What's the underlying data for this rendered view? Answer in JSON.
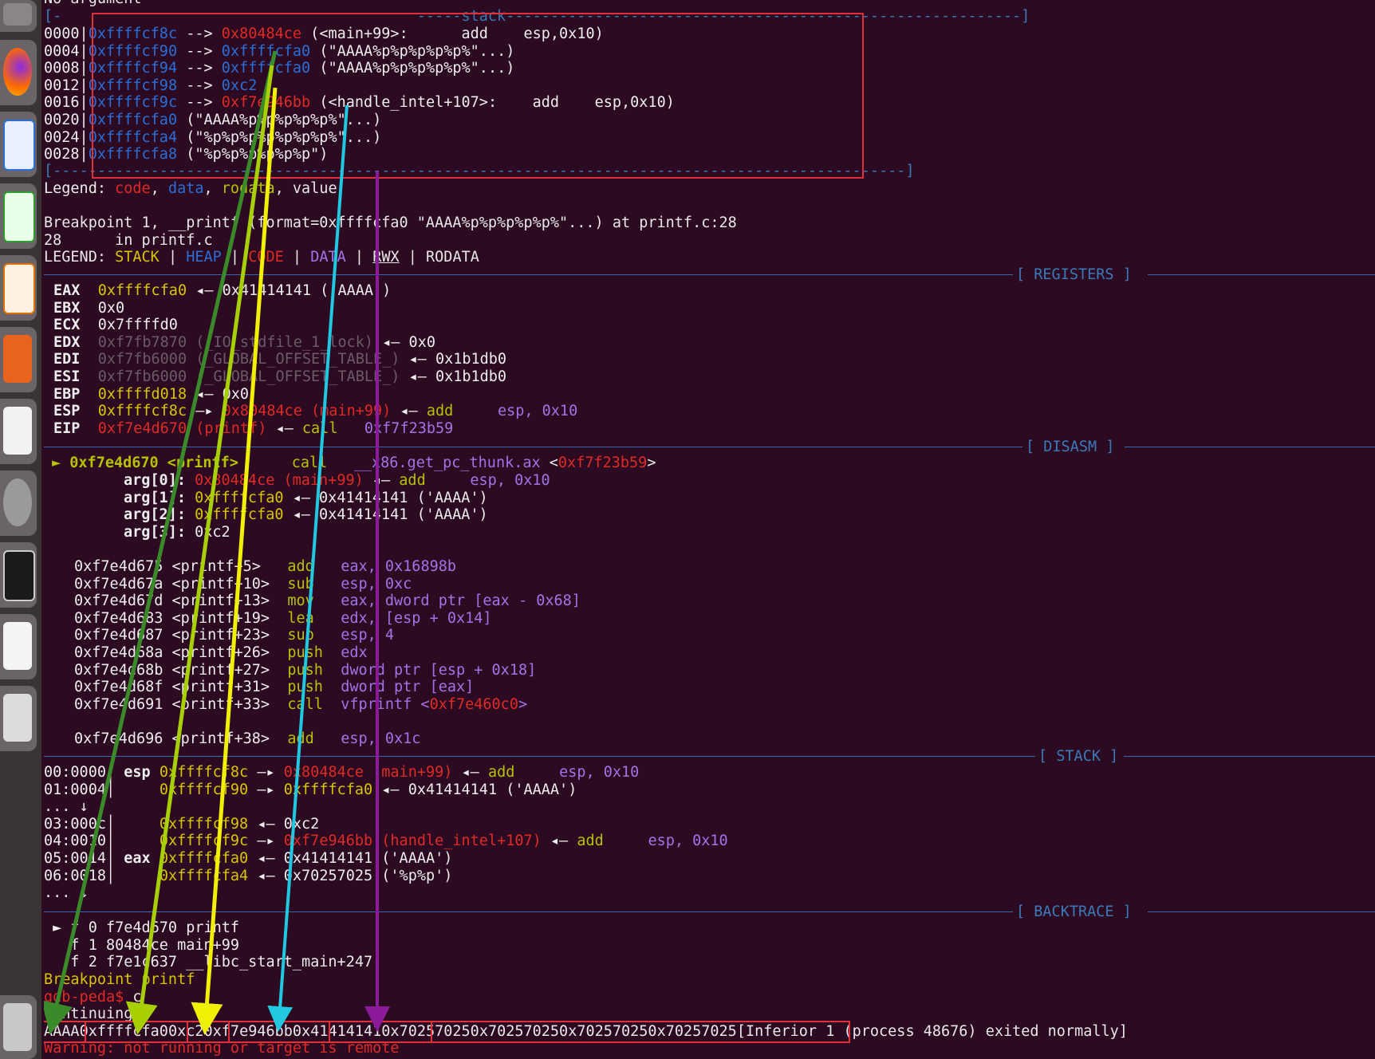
{
  "header": {
    "cut_line": "No argument"
  },
  "stack_top": {
    "section": "stack",
    "rows": [
      {
        "off": "0000|",
        "addr": "0xffffcf8c",
        "arrow": " --> ",
        "val": "0x80484ce",
        "rest": " (<main+99>:      add    esp,0x10)"
      },
      {
        "off": "0004|",
        "addr": "0xffffcf90",
        "arrow": " --> ",
        "val": "0xffffcfa0",
        "rest": " (\"AAAA%p%p%p%p%p%\"...)"
      },
      {
        "off": "0008|",
        "addr": "0xffffcf94",
        "arrow": " --> ",
        "val": "0xffffcfa0",
        "rest": " (\"AAAA%p%p%p%p%p%\"...)"
      },
      {
        "off": "0012|",
        "addr": "0xffffcf98",
        "arrow": " --> ",
        "val": "0xc2",
        "rest": ""
      },
      {
        "off": "0016|",
        "addr": "0xffffcf9c",
        "arrow": " --> ",
        "val": "0xf7e946bb",
        "rest": " (<handle_intel+107>:    add    esp,0x10)"
      },
      {
        "off": "0020|",
        "addr": "0xffffcfa0",
        "arrow": " ",
        "val": "",
        "rest": "(\"AAAA%p%p%p%p%p%\"...)"
      },
      {
        "off": "0024|",
        "addr": "0xffffcfa4",
        "arrow": " ",
        "val": "",
        "rest": "(\"%p%p%p%p%p%p%p%\"...)"
      },
      {
        "off": "0028|",
        "addr": "0xffffcfa8",
        "arrow": " ",
        "val": "",
        "rest": "(\"%p%p%p%p%p%p\")"
      }
    ],
    "legend_label": "Legend: ",
    "legend_code": "code",
    "legend_data": "data",
    "legend_rodata": "rodata",
    "legend_value": "value"
  },
  "bp": {
    "line1": "Breakpoint 1, __printf (format=0xffffcfa0 \"AAAA%p%p%p%p%p%\"...) at printf.c:28",
    "line2": "28\tin printf.c",
    "legend_label": "LEGEND: ",
    "stack": "STACK",
    "heap": "HEAP",
    "code": "CODE",
    "data": "DATA",
    "rwx": "RWX",
    "rodata": "RODATA",
    "sep": " | "
  },
  "sections": {
    "registers": "[ REGISTERS ]",
    "disasm": "[ DISASM ]",
    "stack": "[ STACK ]",
    "backtrace": "[ BACKTRACE ]"
  },
  "registers": [
    {
      "name": "EAX",
      "val": "0xffffcfa0",
      "rest": " ◂— 0x41414141 ('AAAA')"
    },
    {
      "name": "EBX",
      "val": "0x0",
      "rest": ""
    },
    {
      "name": "ECX",
      "val": "0x7ffffd0",
      "rest": ""
    },
    {
      "name": "EDX",
      "val": "0xf7fb7870",
      "sym": " (_IO_stdfile_1_lock)",
      "rest": " ◂— 0x0"
    },
    {
      "name": "EDI",
      "val": "0xf7fb6000",
      "sym": " (_GLOBAL_OFFSET_TABLE_)",
      "rest": " ◂— 0x1b1db0"
    },
    {
      "name": "ESI",
      "val": "0xf7fb6000",
      "sym": " (_GLOBAL_OFFSET_TABLE_)",
      "rest": " ◂— 0x1b1db0"
    },
    {
      "name": "EBP",
      "val": "0xffffd018",
      "rest": " ◂— 0x0"
    },
    {
      "name": "ESP",
      "val": "0xffffcf8c",
      "ptr": " —▸ ",
      "code": "0x80484ce (main+99)",
      "rest": " ◂— ",
      "ins": "add",
      "sp": "     ",
      "op": "esp, 0x10"
    },
    {
      "name": "EIP",
      "val": "0xf7e4d670",
      "sym2": " (printf)",
      "rest": " ◂— ",
      "ins": "call",
      "sp": "   ",
      "op": "0xf7f23b59"
    }
  ],
  "disasm": {
    "current": {
      "marker": "►",
      "addr": "0xf7e4d670",
      "sym": " <printf>",
      "ins": "call",
      "target": "__x86.get_pc_thunk.ax",
      "ref_open": " <",
      "ref": "0xf7f23b59",
      "ref_close": ">"
    },
    "args": [
      {
        "label": "arg[0]: ",
        "val": "0x80484ce (main+99)",
        "rest": " ◂— ",
        "ins": "add",
        "op": "     esp, 0x10"
      },
      {
        "label": "arg[1]: ",
        "val": "0xffffcfa0",
        "rest": " ◂— 0x41414141 ('AAAA')"
      },
      {
        "label": "arg[2]: ",
        "val": "0xffffcfa0",
        "rest": " ◂— 0x41414141 ('AAAA')"
      },
      {
        "label": "arg[3]: ",
        "val": "0xc2",
        "rest": ""
      }
    ],
    "lines": [
      {
        "addr": "0xf7e4d675",
        "sym": "<printf+5>",
        "ins": "add",
        "op": "eax, ",
        "imm": "0x16898b"
      },
      {
        "addr": "0xf7e4d67a",
        "sym": "<printf+10>",
        "ins": "sub",
        "op": "esp, ",
        "imm": "0xc"
      },
      {
        "addr": "0xf7e4d67d",
        "sym": "<printf+13>",
        "ins": "mov",
        "op": "eax, dword ptr [eax - ",
        "imm": "0x68",
        "tail": "]"
      },
      {
        "addr": "0xf7e4d683",
        "sym": "<printf+19>",
        "ins": "lea",
        "op": "edx, [esp + ",
        "imm": "0x14",
        "tail": "]"
      },
      {
        "addr": "0xf7e4d687",
        "sym": "<printf+23>",
        "ins": "sub",
        "op": "esp, ",
        "imm": "4"
      },
      {
        "addr": "0xf7e4d68a",
        "sym": "<printf+26>",
        "ins": "push",
        "op": "edx",
        "imm": ""
      },
      {
        "addr": "0xf7e4d68b",
        "sym": "<printf+27>",
        "ins": "push",
        "op": "dword ptr [esp + ",
        "imm": "0x18",
        "tail": "]"
      },
      {
        "addr": "0xf7e4d68f",
        "sym": "<printf+31>",
        "ins": "push",
        "op": "dword ptr [eax]",
        "imm": ""
      },
      {
        "addr": "0xf7e4d691",
        "sym": "<printf+33>",
        "ins": "call",
        "op": "vfprintf <",
        "red": "0xf7e460c0",
        "tail": ">"
      },
      {
        "addr": "0xf7e4d696",
        "sym": "<printf+38>",
        "ins": "add",
        "op": "esp, ",
        "imm": "0x1c"
      }
    ]
  },
  "stack": {
    "rows": [
      {
        "idx": "00:0000│",
        "reg": " esp ",
        "addr": "0xffffcf8c",
        "ptr": " —▸ ",
        "red": "0x80484ce (main+99)",
        "rest": " ◂— ",
        "ins": "add",
        "op": "     esp, 0x10"
      },
      {
        "idx": "01:0004│",
        "reg": "     ",
        "addr": "0xffffcf90",
        "ptr": " —▸ ",
        "yel": "0xffffcfa0",
        "rest": " ◂— 0x41414141 ('AAAA')"
      },
      {
        "idx": "... ↓",
        "reg": "",
        "addr": "",
        "ptr": "",
        "rest": ""
      },
      {
        "idx": "03:000c│",
        "reg": "     ",
        "addr": "0xffffcf98",
        "ptr": " ◂— ",
        "rest": "0xc2"
      },
      {
        "idx": "04:0010│",
        "reg": "     ",
        "addr": "0xffffcf9c",
        "ptr": " —▸ ",
        "red": "0xf7e946bb (handle_intel+107)",
        "rest": " ◂— ",
        "ins": "add",
        "op": "     esp, 0x10"
      },
      {
        "idx": "05:0014│",
        "reg": " eax ",
        "addr": "0xffffcfa0",
        "ptr": " ◂— ",
        "rest": "0x41414141 ('AAAA')"
      },
      {
        "idx": "06:0018│",
        "reg": "     ",
        "addr": "0xffffcfa4",
        "ptr": " ◂— ",
        "rest": "0x70257025 ('%p%p')"
      },
      {
        "idx": "... ↓",
        "reg": "",
        "addr": "",
        "ptr": "",
        "rest": ""
      }
    ]
  },
  "backtrace": [
    {
      "mark": " ► f 0 ",
      "addr": "f7e4d670",
      "fn": " printf"
    },
    {
      "mark": "   f 1 ",
      "addr": "80484ce",
      "fn": " main+99"
    },
    {
      "mark": "   f 2 ",
      "addr": "f7e1c637",
      "fn": " __libc_start_main+247"
    }
  ],
  "tail": {
    "bp_line": "Breakpoint printf",
    "prompt": "gdb-peda$ ",
    "cmd": "c",
    "continuing": "Continuing.",
    "out_aaaa": "AAAA",
    "out_1": "0xffffcfa0",
    "out_2": "0xc2",
    "out_3": "0xf7e946bb",
    "out_4": "0x41414141",
    "out_5": "0x702570250x702570250x702570250x70257025",
    "exit_msg": "[Inferior 1 (process 48676) exited normally]",
    "warning": "Warning: not running or target is remote"
  },
  "colors": {
    "box": "#e0303a",
    "arrow_green": "#3a8a2a",
    "arrow_lime": "#a8d000",
    "arrow_yellow": "#f0f000",
    "arrow_cyan": "#20c8e0",
    "arrow_purple": "#8a1a9a"
  }
}
